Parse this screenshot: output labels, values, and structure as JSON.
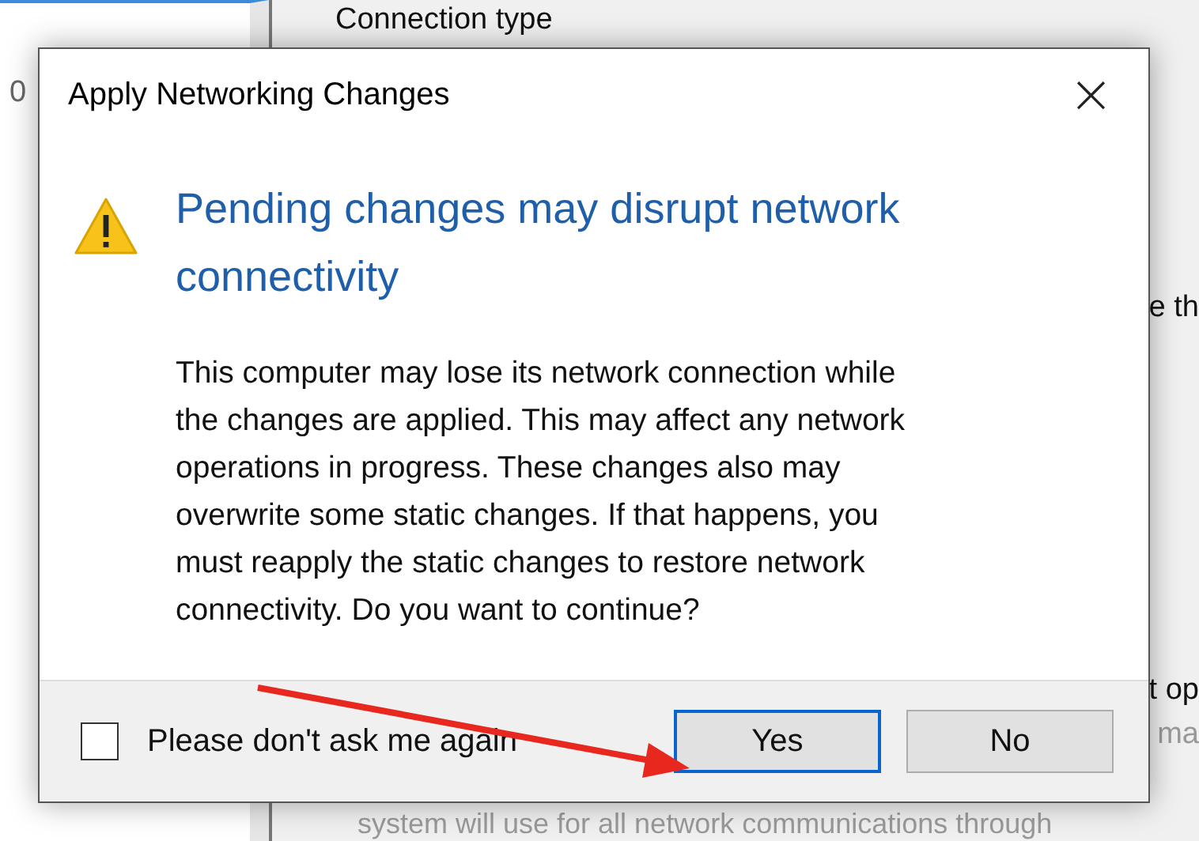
{
  "background": {
    "left_fragment": "0",
    "group_label": "Connection type",
    "fragments": [
      "e th",
      "t op",
      "ma"
    ],
    "bottom_line": "system will use for all network communications through"
  },
  "dialog": {
    "title": "Apply Networking Changes",
    "close": "×",
    "heading": "Pending changes may disrupt network\nconnectivity",
    "body": "This computer may lose its network connection while\nthe changes are applied. This may affect any network\noperations in progress. These changes also may\noverwrite some static changes. If that happens, you\nmust reapply the static changes to restore network\nconnectivity. Do you want to continue?",
    "checkbox": {
      "label": "Please don't ask me again",
      "checked": false
    },
    "buttons": [
      {
        "label": "Yes",
        "selected": true
      },
      {
        "label": "No",
        "selected": false
      }
    ]
  },
  "annotation": {
    "kind": "arrow",
    "color": "#e8281e"
  }
}
